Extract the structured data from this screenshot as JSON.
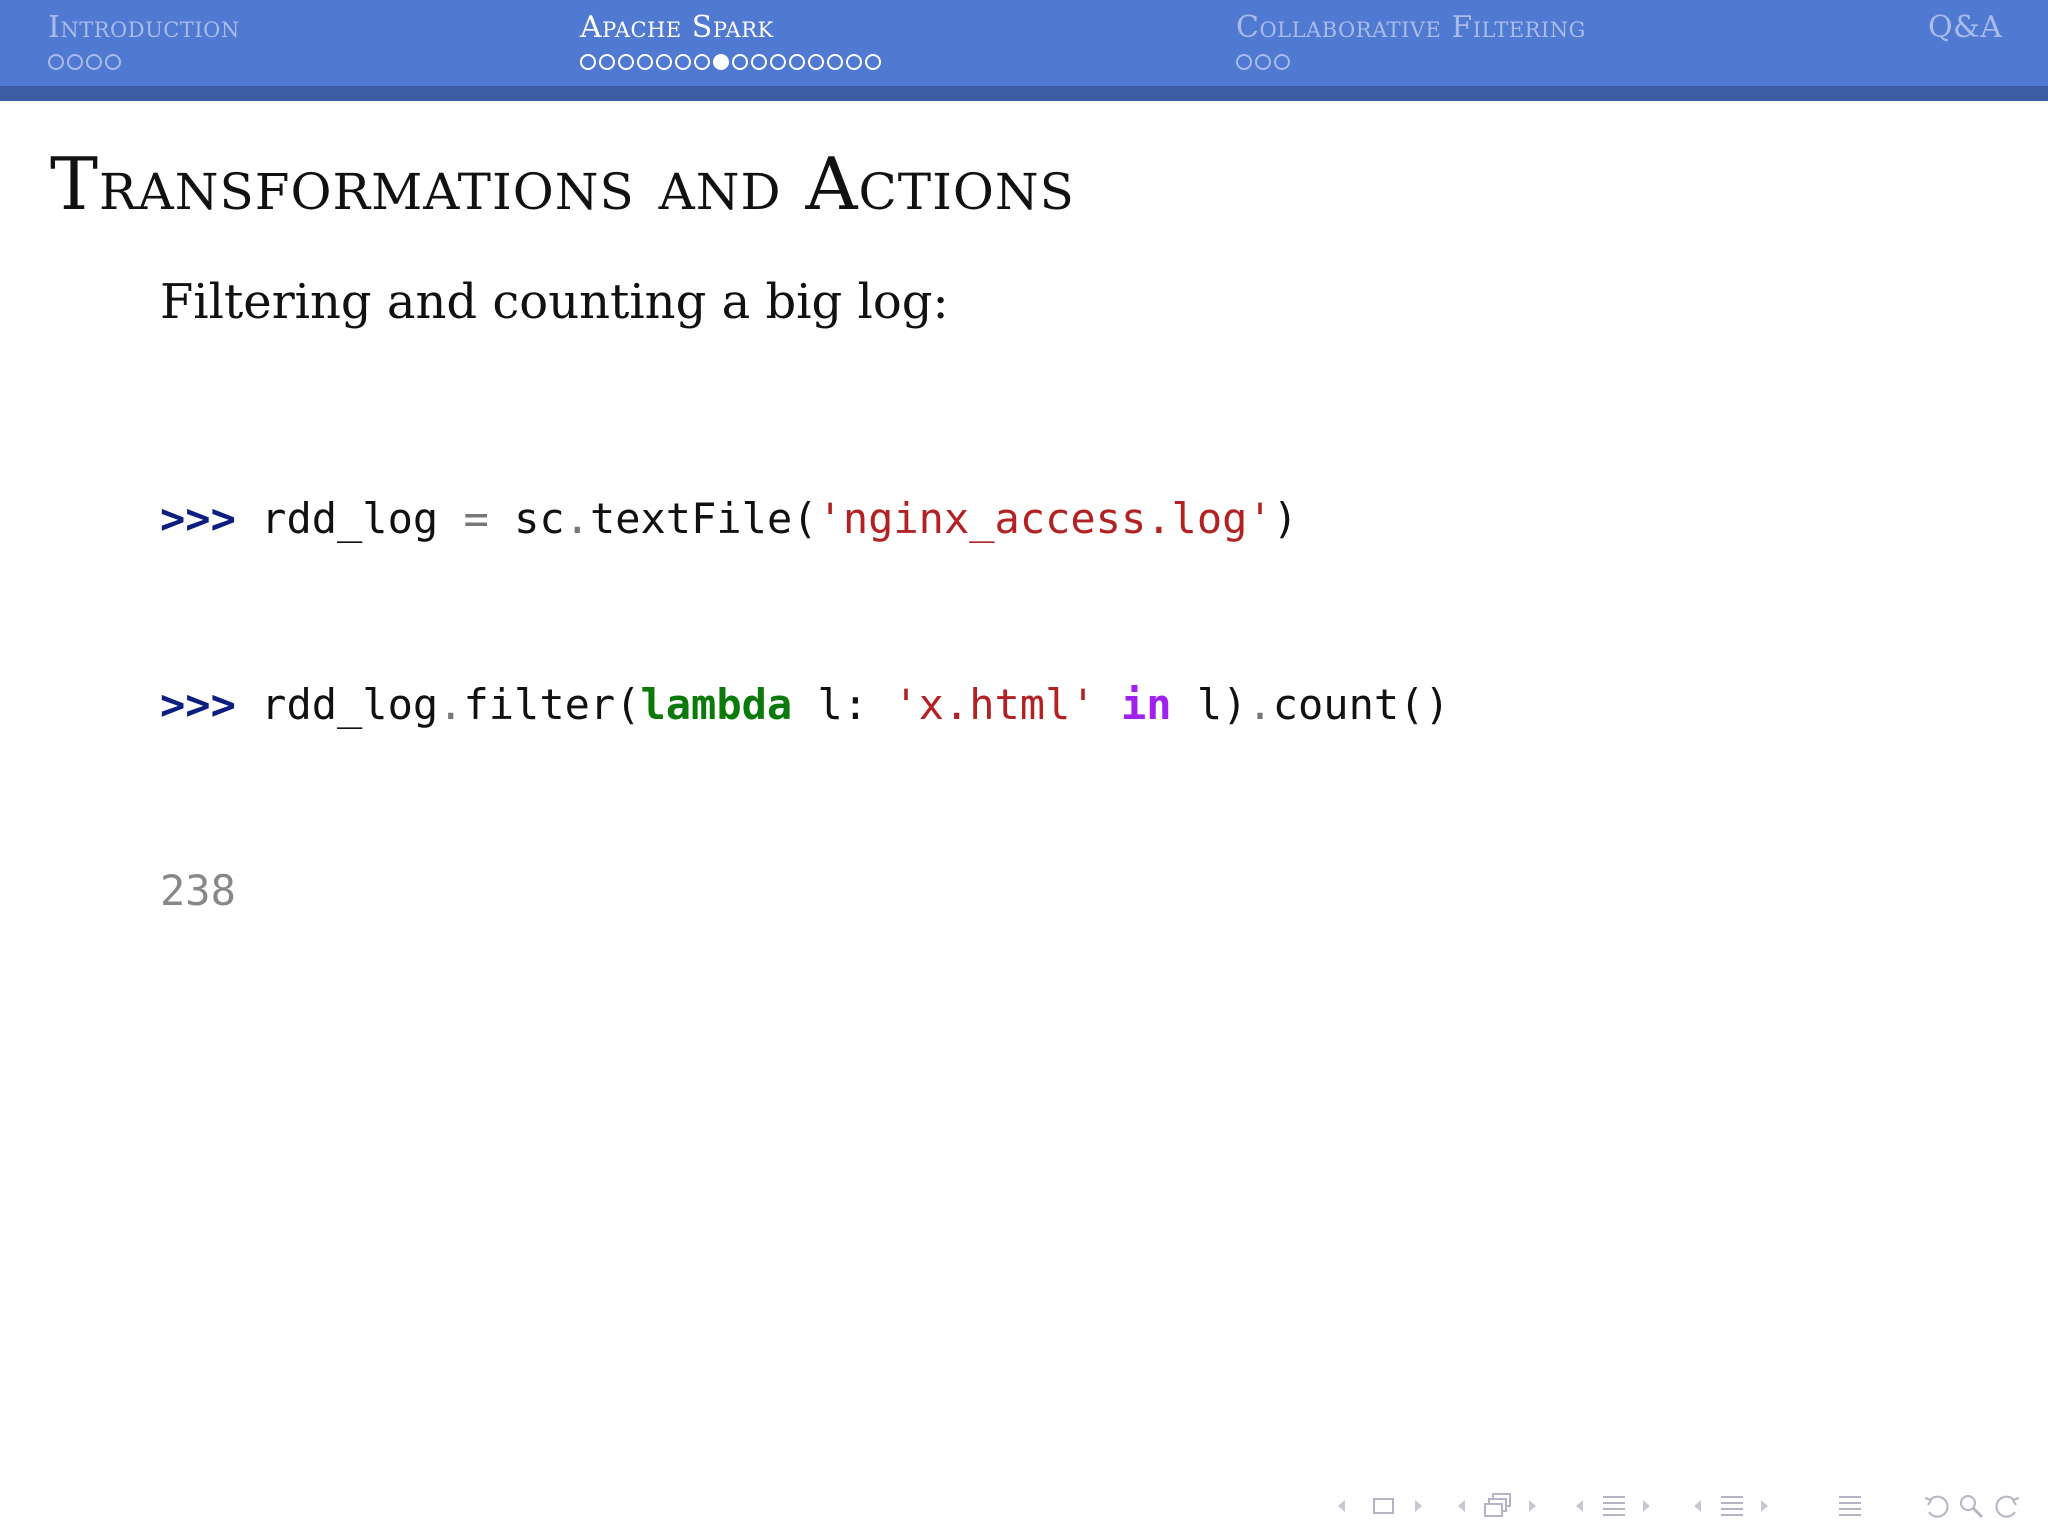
{
  "header": {
    "sections": [
      {
        "id": "introduction",
        "title": "Introduction",
        "subsections": 4,
        "current_index": -1,
        "active": false
      },
      {
        "id": "apache-spark",
        "title": "Apache Spark",
        "subsections": 16,
        "current_index": 7,
        "active": true
      },
      {
        "id": "collaborative-filtering",
        "title": "Collaborative Filtering",
        "subsections": 3,
        "current_index": -1,
        "active": false
      },
      {
        "id": "qa",
        "title": "Q&A",
        "subsections": 0,
        "current_index": -1,
        "active": false
      }
    ]
  },
  "frame": {
    "title": "Transformations and Actions",
    "intro": "Filtering and counting a big log:",
    "code": {
      "line1": {
        "prompt": ">>>",
        "var": "rdd_log",
        "assign": "=",
        "obj": "sc",
        "dot": ".",
        "method": "textFile",
        "open": "(",
        "str": "'nginx_access.log'",
        "close": ")"
      },
      "line2": {
        "prompt": ">>>",
        "var": "rdd_log",
        "dot1": ".",
        "method1": "filter",
        "open1": "(",
        "kw": "lambda",
        "param": "l:",
        "str": "'x.html'",
        "opword": "in",
        "arg": "l)",
        "dot2": ".",
        "method2": "count",
        "parens": "()"
      },
      "output": "238"
    }
  },
  "colors": {
    "header_bg": "#5079d1",
    "header_strip": "#3e5ea3",
    "header_inactive_text": "#a9bce9",
    "header_active_text": "#ffffff",
    "prompt": "#0c1e80",
    "string": "#b22222",
    "keyword": "#0b7a0b",
    "operator_word": "#a020f0",
    "output": "#888888"
  },
  "nav_symbols": [
    "frame-prev-icon",
    "frame-icon",
    "frame-next-icon",
    "subsection-prev-icon",
    "subsection-icon",
    "subsection-next-icon",
    "section-prev-icon",
    "section-icon",
    "section-next-icon",
    "document-prev-icon",
    "document-icon",
    "document-next-icon",
    "appendix-icon",
    "back-icon",
    "search-icon",
    "forward-icon"
  ]
}
